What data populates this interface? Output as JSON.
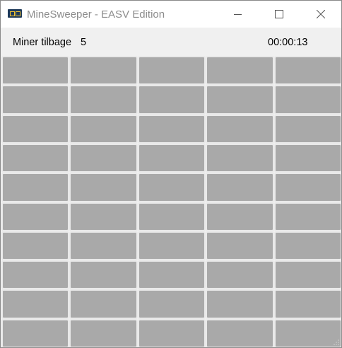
{
  "window": {
    "title": "MineSweeper - EASV Edition",
    "icon": "app-icon"
  },
  "title_buttons": {
    "minimize": "minimize-icon",
    "maximize": "maximize-icon",
    "close": "close-icon"
  },
  "status": {
    "mines_label": "Miner tilbage",
    "mines_count": "5",
    "timer": "00:00:13"
  },
  "board": {
    "rows": 10,
    "cols": 5,
    "cell_state": "unrevealed",
    "cell_color": "#a9a9a9"
  }
}
